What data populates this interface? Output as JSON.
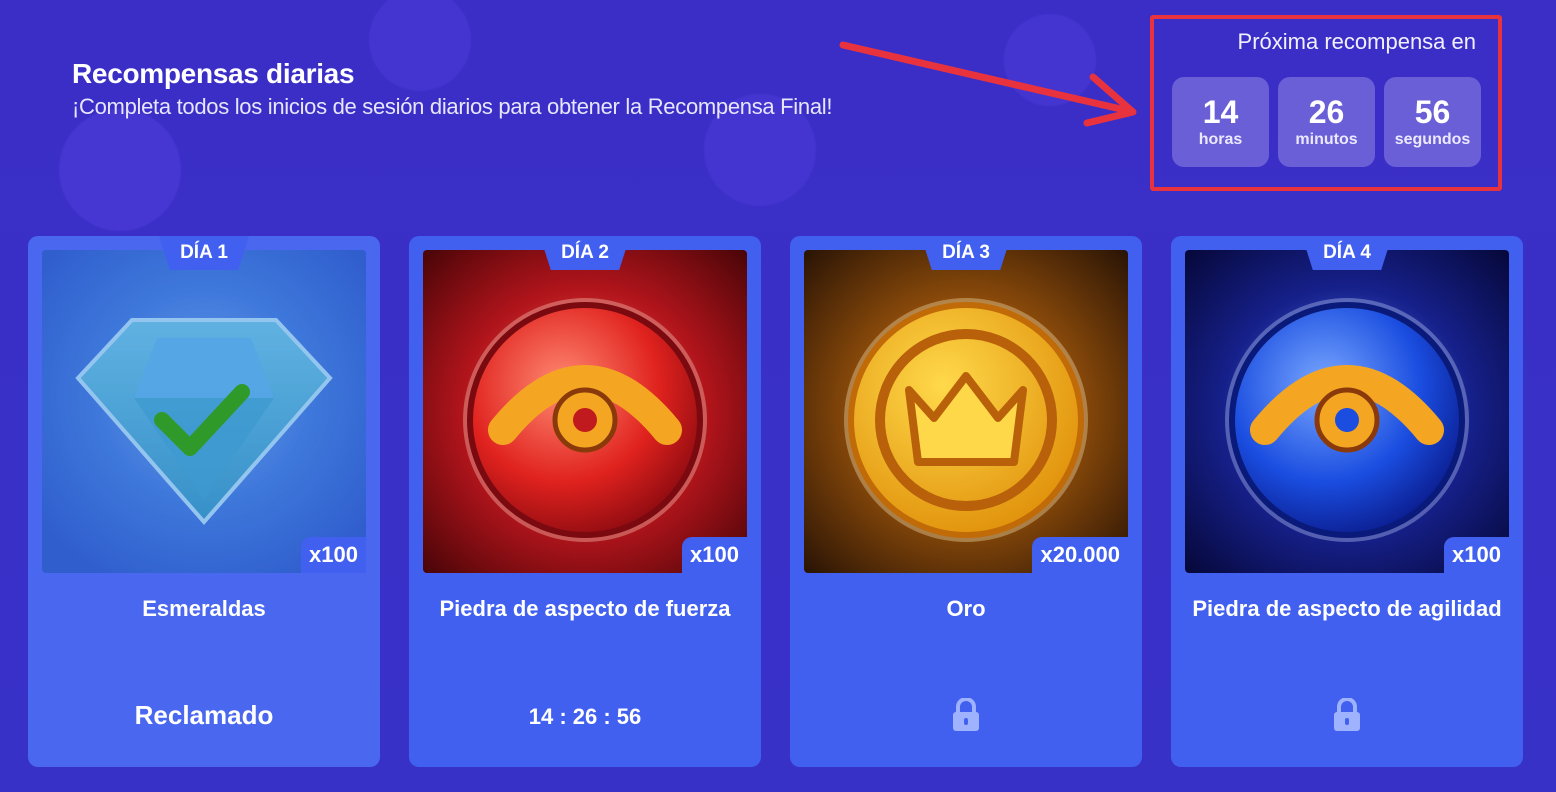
{
  "header": {
    "title": "Recompensas diarias",
    "subtitle": "¡Completa todos los inicios de sesión diarios para obtener la Recompensa Final!"
  },
  "next_reward": {
    "label": "Próxima recompensa en",
    "hours": "14",
    "hours_label": "horas",
    "minutes": "26",
    "minutes_label": "minutos",
    "seconds": "56",
    "seconds_label": "segundos"
  },
  "cards": [
    {
      "day": "DÍA 1",
      "qty": "x100",
      "name": "Esmeraldas",
      "status": "Reclamado",
      "icon": "emerald-icon"
    },
    {
      "day": "DÍA 2",
      "qty": "x100",
      "name": "Piedra de aspecto de fuerza",
      "status": "14 : 26 : 56",
      "icon": "strength-aspect-stone-icon"
    },
    {
      "day": "DÍA 3",
      "qty": "x20.000",
      "name": "Oro",
      "status_icon": "lock-icon",
      "icon": "gold-coin-icon"
    },
    {
      "day": "DÍA 4",
      "qty": "x100",
      "name": "Piedra de aspecto de agilidad",
      "status_icon": "lock-icon",
      "icon": "agility-aspect-stone-icon"
    }
  ],
  "colors": {
    "background": "#3a2fc4",
    "card": "#4160ef",
    "highlight": "#e8333f"
  }
}
